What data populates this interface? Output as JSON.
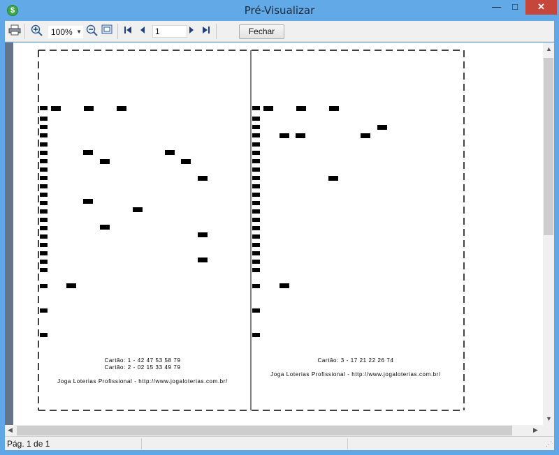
{
  "window": {
    "title": "Pré-Visualizar",
    "icon": "dollar-coin-icon",
    "close_color": "#c7463b"
  },
  "toolbar": {
    "print_icon": "printer-icon",
    "zoom_in_icon": "zoom-in-icon",
    "zoom_value": "100%",
    "zoom_out_icon": "zoom-out-icon",
    "fit_page_icon": "fit-page-icon",
    "first_icon": "first-page-icon",
    "prev_icon": "previous-page-icon",
    "page_value": "1",
    "next_icon": "next-page-icon",
    "last_icon": "last-page-icon",
    "close_label": "Fechar"
  },
  "tickets": [
    {
      "lines": [
        "Cartão: 1 - 42 47 53 58 79",
        "Cartão: 2 - 02 15 33 49 79"
      ],
      "footer": "Joga Loterias Profissional - http://www.jogaloterias.com.br/"
    },
    {
      "lines": [
        "Cartão: 3 - 17 21 22 26 74"
      ],
      "footer": "Joga Loterias Profissional - http://www.jogaloterias.com.br/"
    }
  ],
  "status": {
    "page_label": "Pág. 1 de 1"
  }
}
